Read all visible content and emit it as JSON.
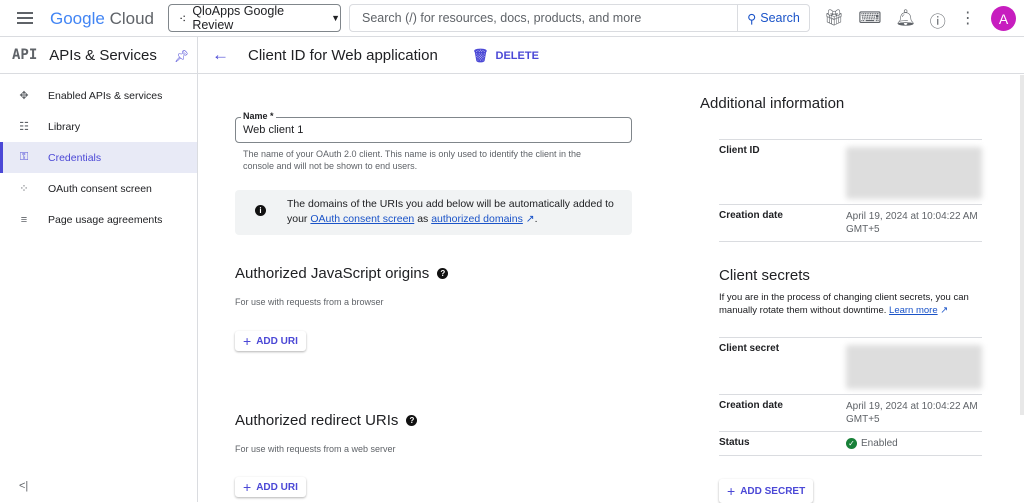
{
  "topbar": {
    "logo_google": "Google",
    "logo_cloud": "Cloud",
    "project": "QloApps Google Review",
    "search_placeholder": "Search (/) for resources, docs, products, and more",
    "search_button": "Search",
    "avatar": "A"
  },
  "sidebar": {
    "logo": "API",
    "title": "APIs & Services",
    "items": [
      {
        "label": "Enabled APIs & services",
        "icon": "✥"
      },
      {
        "label": "Library",
        "icon": "☷"
      },
      {
        "label": "Credentials",
        "icon": "⚿"
      },
      {
        "label": "OAuth consent screen",
        "icon": "⁘"
      },
      {
        "label": "Page usage agreements",
        "icon": "≡"
      }
    ],
    "collapse": "<|"
  },
  "header": {
    "title": "Client ID for Web application",
    "delete": "DELETE"
  },
  "form": {
    "name_label": "Name *",
    "name_value": "Web client 1",
    "name_help": "The name of your OAuth 2.0 client. This name is only used to identify the client in the console and will not be shown to end users.",
    "info_text1": "The domains of the URIs you add below will be automatically added to your",
    "info_link1": "OAuth consent screen",
    "info_as": "as",
    "info_link2": "authorized domains",
    "js_title": "Authorized JavaScript origins",
    "js_sub": "For use with requests from a browser",
    "add_uri": "ADD URI",
    "redir_title": "Authorized redirect URIs",
    "redir_sub": "For use with requests from a web server"
  },
  "info": {
    "title": "Additional information",
    "client_id_label": "Client ID",
    "creation_label": "Creation date",
    "creation_value": "April 19, 2024 at 10:04:22 AM GMT+5",
    "secrets_title": "Client secrets",
    "secrets_desc": "If you are in the process of changing client secrets, you can manually rotate them without downtime.",
    "learn_more": "Learn more",
    "secret_label": "Client secret",
    "secret_creation_label": "Creation date",
    "secret_creation_value": "April 19, 2024 at 10:04:22 AM GMT+5",
    "status_label": "Status",
    "status_value": "Enabled",
    "add_secret": "ADD SECRET"
  }
}
